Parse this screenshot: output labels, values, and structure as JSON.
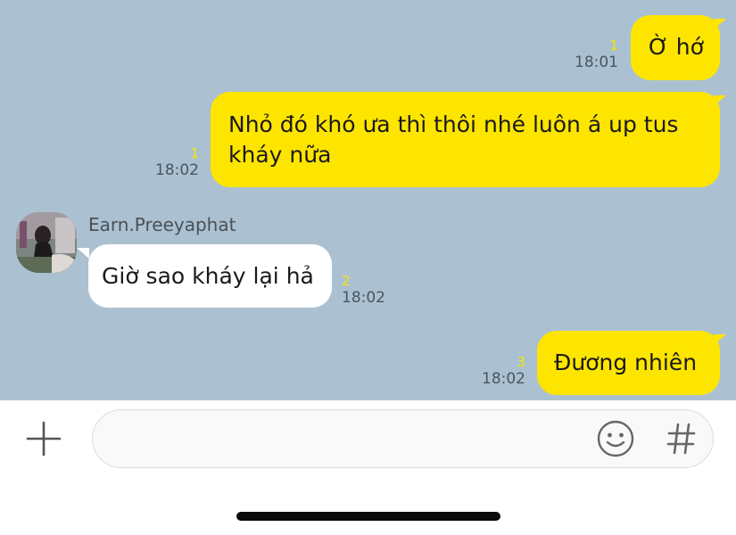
{
  "messages": [
    {
      "direction": "out",
      "text": "Ờ hớ",
      "unread": "1",
      "time": "18:01"
    },
    {
      "direction": "out",
      "text": "Nhỏ đó khó ưa thì thôi nhé luôn á up tus kháy nữa",
      "unread": "1",
      "time": "18:02"
    },
    {
      "direction": "in",
      "sender": "Earn.Preeyaphat",
      "text": "Giờ sao kháy lại hả",
      "unread": "2",
      "time": "18:02"
    },
    {
      "direction": "out",
      "text": "Đương nhiên",
      "unread": "3",
      "time": "18:02"
    }
  ],
  "composer": {
    "placeholder": "",
    "value": ""
  },
  "icons": {
    "add": "plus-icon",
    "emoji": "smiley-icon",
    "hashtag": "hash-icon"
  },
  "colors": {
    "chat_background": "#abc1d1",
    "outgoing_bubble": "#fee500",
    "incoming_bubble": "#ffffff",
    "unread_count": "#f7e600"
  }
}
